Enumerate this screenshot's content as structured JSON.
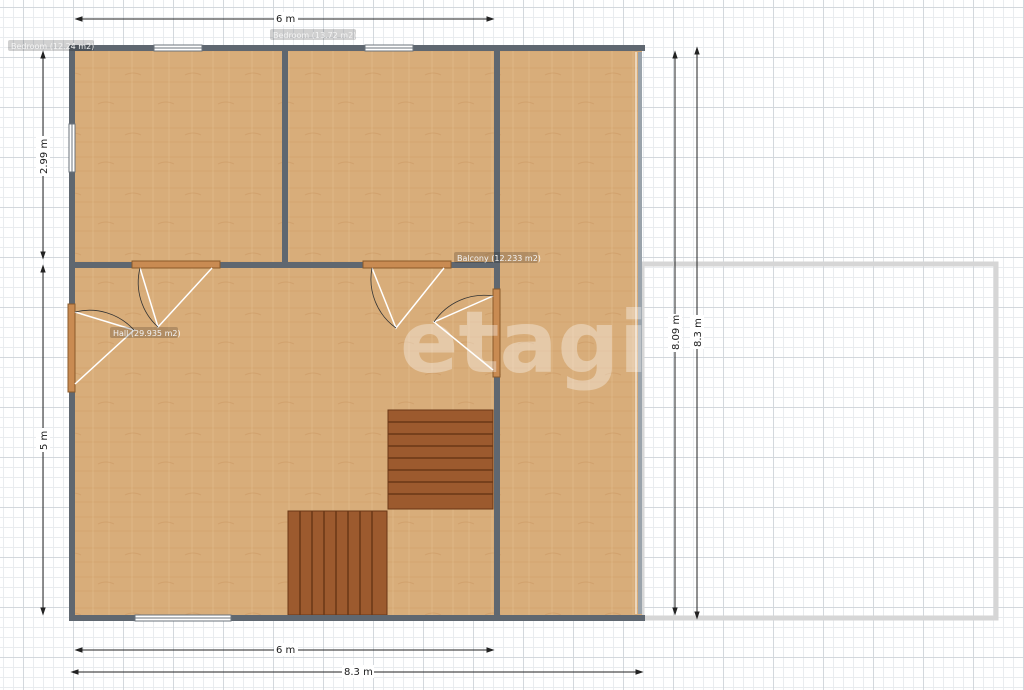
{
  "rooms": {
    "bedroom1": "Bedroom (12.24 m2)",
    "bedroom2": "Bedroom (13.72 m2)",
    "balcony": "Balcony (12.233 m2)",
    "hall": "Hall (29.935 m2)"
  },
  "dimensions": {
    "top_width": "6 m",
    "bottom_width_inner": "6 m",
    "bottom_width_total": "8.3 m",
    "left_upper": "2.99 m",
    "left_lower": "5 m",
    "right_inner": "8.09 m",
    "right_total": "8.3 m"
  },
  "watermark": "etagi",
  "colors": {
    "floor": "#d8ad7a",
    "wall": "#5f6770",
    "stairs": "#9c5a2e",
    "door": "#c98b52",
    "grid": "#d3d8dd",
    "terrace_outline": "#d6d6d6"
  }
}
